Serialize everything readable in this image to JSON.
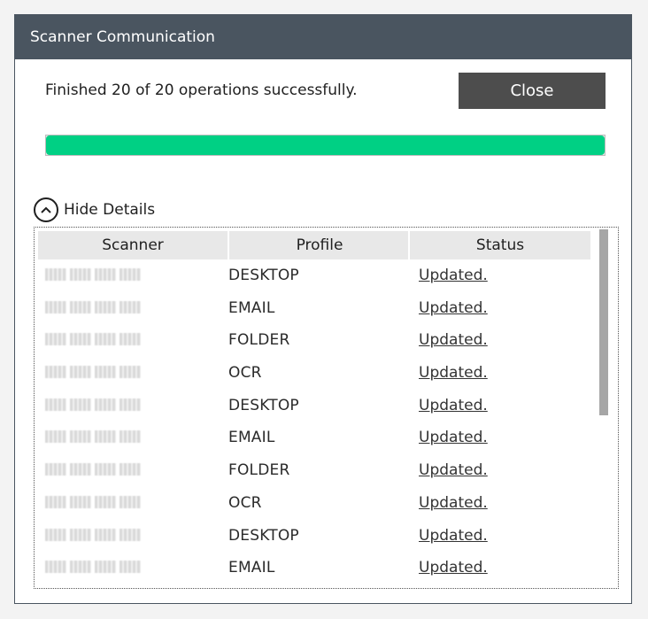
{
  "window": {
    "title": "Scanner Communication"
  },
  "status": {
    "message": "Finished 20 of 20 operations successfully."
  },
  "close_button": {
    "label": "Close"
  },
  "progress": {
    "percent": 100,
    "fill_color": "#00d084"
  },
  "details_toggle": {
    "label": "Hide Details"
  },
  "table": {
    "headers": {
      "scanner": "Scanner",
      "profile": "Profile",
      "status": "Status"
    },
    "rows": [
      {
        "profile": "DESKTOP",
        "status": "Updated."
      },
      {
        "profile": "EMAIL",
        "status": "Updated."
      },
      {
        "profile": "FOLDER",
        "status": "Updated."
      },
      {
        "profile": "OCR",
        "status": "Updated."
      },
      {
        "profile": "DESKTOP",
        "status": "Updated."
      },
      {
        "profile": "EMAIL",
        "status": "Updated."
      },
      {
        "profile": "FOLDER",
        "status": "Updated."
      },
      {
        "profile": "OCR",
        "status": "Updated."
      },
      {
        "profile": "DESKTOP",
        "status": "Updated."
      },
      {
        "profile": "EMAIL",
        "status": "Updated."
      }
    ]
  }
}
